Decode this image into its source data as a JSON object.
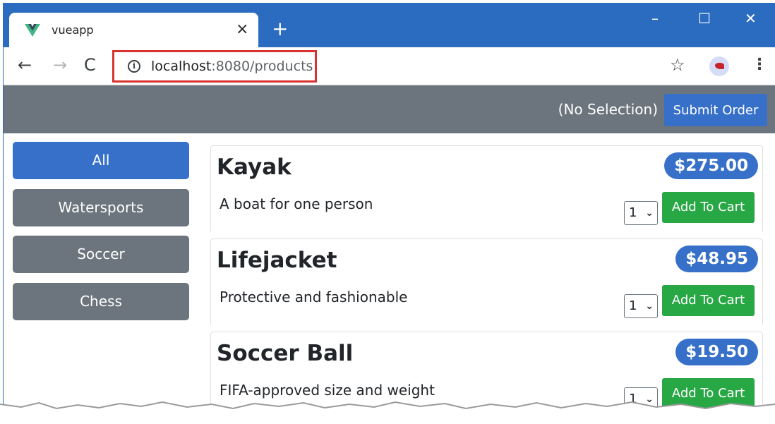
{
  "browser": {
    "tab_title": "vueapp",
    "tab_close": "×",
    "new_tab": "+",
    "window_controls": {
      "minimize": "–",
      "maximize": "☐",
      "close": "✕"
    },
    "nav": {
      "back": "←",
      "forward": "→",
      "reload": "C"
    },
    "url": {
      "host": "localhost",
      "rest": ":8080/products"
    },
    "info_icon": "i",
    "star": "☆",
    "menu": "⋮",
    "icons": [
      "vue-logo-icon",
      "info-icon",
      "star-icon",
      "profile-avatar-icon",
      "kebab-menu-icon"
    ]
  },
  "header": {
    "selection": "(No Selection)",
    "submit_label": "Submit Order"
  },
  "categories": [
    {
      "label": "All",
      "active": true
    },
    {
      "label": "Watersports",
      "active": false
    },
    {
      "label": "Soccer",
      "active": false
    },
    {
      "label": "Chess",
      "active": false
    }
  ],
  "products": [
    {
      "name": "Kayak",
      "price": "$275.00",
      "description": "A boat for one person",
      "qty": "1",
      "add_label": "Add To Cart"
    },
    {
      "name": "Lifejacket",
      "price": "$48.95",
      "description": "Protective and fashionable",
      "qty": "1",
      "add_label": "Add To Cart"
    },
    {
      "name": "Soccer Ball",
      "price": "$19.50",
      "description": "FIFA-approved size and weight",
      "qty": "1",
      "add_label": "Add To Cart"
    }
  ],
  "colors": {
    "chrome_blue": "#2b6cc0",
    "header_gray": "#6c757d",
    "primary": "#3670c8",
    "success": "#28a745",
    "highlight_red": "#d9322e"
  }
}
